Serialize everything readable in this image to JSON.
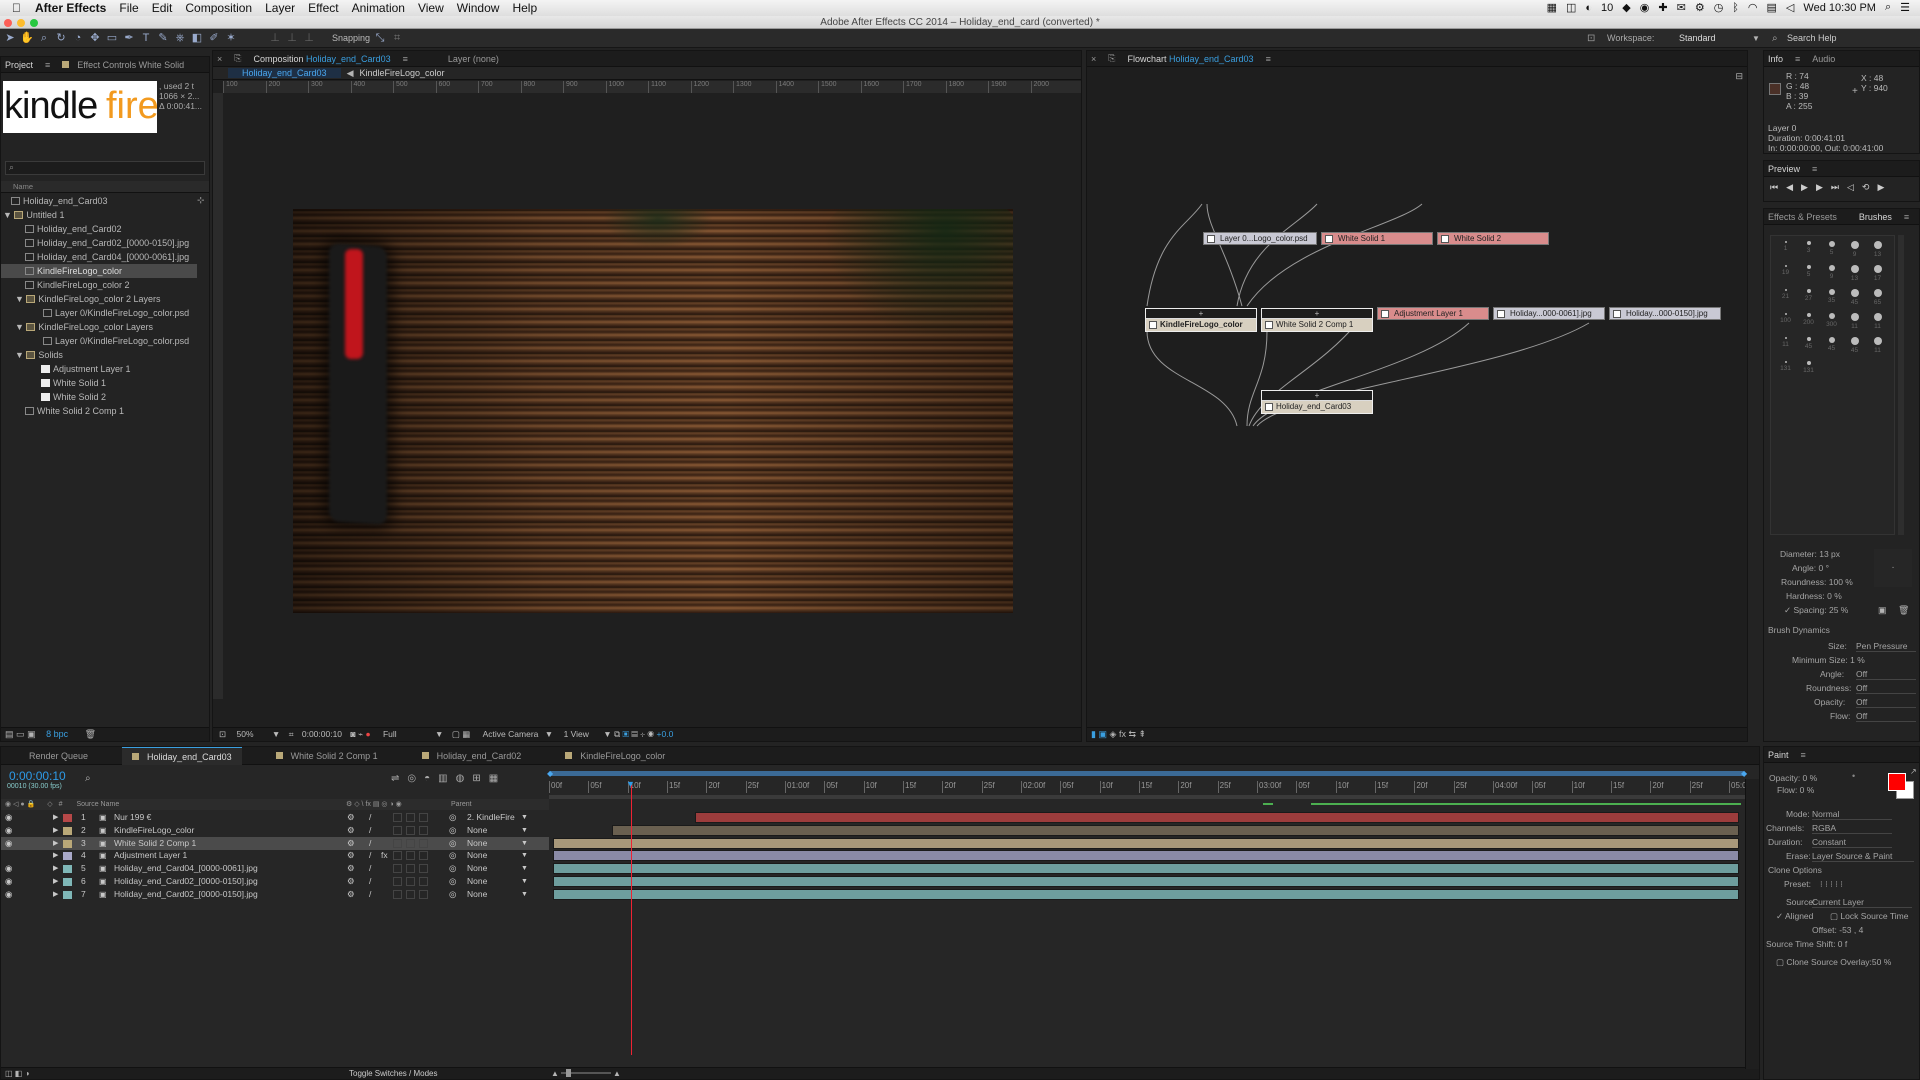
{
  "menubar": {
    "items": [
      "After Effects",
      "File",
      "Edit",
      "Composition",
      "Layer",
      "Effect",
      "Animation",
      "View",
      "Window",
      "Help"
    ],
    "clock": "Wed 10:30 PM",
    "badge": "10"
  },
  "window": {
    "title": "Adobe After Effects CC 2014 – Holiday_end_card (converted) *"
  },
  "toolbar": {
    "snapping": "Snapping",
    "workspace_label": "Workspace:",
    "workspace": "Standard",
    "search": "Search Help"
  },
  "project": {
    "tab": "Project",
    "tab2": "Effect Controls White Solid",
    "logo1": "kindle",
    "logo2": "fire",
    "meta": [
      ", used 2 t",
      "1066 × 2...",
      "Δ 0:00:41..."
    ],
    "col_name": "Name",
    "bpc": "8 bpc",
    "items": [
      "Holiday_end_Card03",
      "Untitled 1",
      "Holiday_end_Card02",
      "Holiday_end_Card02_[0000-0150].jpg",
      "Holiday_end_Card04_[0000-0061].jpg",
      "KindleFireLogo_color",
      "KindleFireLogo_color 2",
      "KindleFireLogo_color 2 Layers",
      "Layer 0/KindleFireLogo_color.psd",
      "KindleFireLogo_color Layers",
      "Layer 0/KindleFireLogo_color.psd",
      "Solids",
      "Adjustment Layer 1",
      "White Solid 1",
      "White Solid 2",
      "White Solid 2 Comp 1"
    ]
  },
  "composition": {
    "tab_label": "Composition",
    "tab_name": "Holiday_end_Card03",
    "layer_tab": "Layer (none)",
    "crumb1": "Holiday_end_Card03",
    "crumb2": "KindleFireLogo_color",
    "ruler": [
      "100",
      "200",
      "300",
      "400",
      "500",
      "600",
      "700",
      "800",
      "900",
      "1000",
      "1100",
      "1200",
      "1300",
      "1400",
      "1500",
      "1600",
      "1700",
      "1800",
      "1900",
      "2000"
    ],
    "zoom": "50%",
    "time": "0:00:00:10",
    "res": "Full",
    "camera": "Active Camera",
    "view": "1 View",
    "exposure": "+0.0"
  },
  "flowchart": {
    "tab_label": "Flowchart",
    "tab_name": "Holiday_end_Card03",
    "nodes": [
      "Layer 0...Logo_color.psd",
      "White Solid 1",
      "White Solid 2",
      "KindleFireLogo_color",
      "White Solid 2 Comp 1",
      "Adjustment Layer 1",
      "Holiday...000-0061].jpg",
      "Holiday...000-0150].jpg",
      "Holiday_end_Card03"
    ]
  },
  "info": {
    "tab": "Info",
    "tab2": "Audio",
    "rgba": [
      "R : 74",
      "G : 48",
      "B : 39",
      "A : 255"
    ],
    "xy": [
      "X : 48",
      "Y : 940"
    ],
    "layer": "Layer 0",
    "duration": "Duration: 0:00:41:01",
    "inout": "In: 0:00:00:00, Out: 0:00:41:00",
    "swatch": "#4a3027"
  },
  "preview": {
    "tab": "Preview"
  },
  "brushes": {
    "tab1": "Effects & Presets",
    "tab2": "Brushes",
    "sizes": [
      "1",
      "3",
      "5",
      "9",
      "13",
      "19",
      "5",
      "9",
      "13",
      "17",
      "21",
      "27",
      "35",
      "45",
      "65",
      "100",
      "200",
      "300",
      "11",
      "11",
      "11",
      "45",
      "45",
      "45",
      "11",
      "131",
      "131"
    ],
    "props": [
      [
        "Diameter:",
        "13 px"
      ],
      [
        "Angle:",
        "0 °"
      ],
      [
        "Roundness:",
        "100 %"
      ],
      [
        "Hardness:",
        "0 %"
      ],
      [
        "Spacing:",
        "25 %"
      ]
    ],
    "dynamics": "Brush Dynamics",
    "dyn": [
      [
        "Size:",
        "Pen Pressure"
      ],
      [
        "Minimum Size:",
        "1 %"
      ],
      [
        "Angle:",
        "Off"
      ],
      [
        "Roundness:",
        "Off"
      ],
      [
        "Opacity:",
        "Off"
      ],
      [
        "Flow:",
        "Off"
      ]
    ]
  },
  "timeline": {
    "tabs": [
      "Render Queue",
      "Holiday_end_Card03",
      "White Solid 2 Comp 1",
      "Holiday_end_Card02",
      "KindleFireLogo_color"
    ],
    "time": "0:00:00:10",
    "fps": "00010 (30.00 fps)",
    "col_source": "Source Name",
    "col_parent": "Parent",
    "toggle": "Toggle Switches / Modes",
    "ticks": [
      "00f",
      "05f",
      "10f",
      "15f",
      "20f",
      "25f",
      "01:00f",
      "05f",
      "10f",
      "15f",
      "20f",
      "25f",
      "02:00f",
      "05f",
      "10f",
      "15f",
      "20f",
      "25f",
      "03:00f",
      "05f",
      "10f",
      "15f",
      "20f",
      "25f",
      "04:00f",
      "05f",
      "10f",
      "15f",
      "20f",
      "25f",
      "05:00"
    ],
    "layers": [
      {
        "n": "1",
        "name": "Nur 199 €",
        "parent": "2. KindleFire",
        "c": "#b64848"
      },
      {
        "n": "2",
        "name": "KindleFireLogo_color",
        "parent": "None",
        "c": "#b9a878"
      },
      {
        "n": "3",
        "name": "White Solid 2 Comp 1",
        "parent": "None",
        "c": "#b9a878"
      },
      {
        "n": "4",
        "name": "Adjustment Layer 1",
        "parent": "None",
        "c": "#a9a9c9"
      },
      {
        "n": "5",
        "name": "Holiday_end_Card04_[0000-0061].jpg",
        "parent": "None",
        "c": "#7fb7b7"
      },
      {
        "n": "6",
        "name": "Holiday_end_Card02_[0000-0150].jpg",
        "parent": "None",
        "c": "#7fb7b7"
      },
      {
        "n": "7",
        "name": "Holiday_end_Card02_[0000-0150].jpg",
        "parent": "None",
        "c": "#7fb7b7"
      }
    ]
  },
  "paint": {
    "tab": "Paint",
    "opacity": "Opacity: 0 %",
    "flow": "Flow: 0 %",
    "rows": [
      [
        "Mode:",
        "Normal"
      ],
      [
        "Channels:",
        "RGBA"
      ],
      [
        "Duration:",
        "Constant"
      ],
      [
        "Erase:",
        "Layer Source & Paint"
      ]
    ],
    "clone": "Clone Options",
    "preset": "Preset:",
    "source": [
      "Source:",
      "Current Layer"
    ],
    "aligned": "Aligned",
    "lock": "Lock Source Time",
    "offset": "Offset: -53 , 4",
    "shift": "Source Time Shift: 0 f",
    "overlay": "Clone Source Overlay:50 %",
    "fg": "#ff0000"
  }
}
